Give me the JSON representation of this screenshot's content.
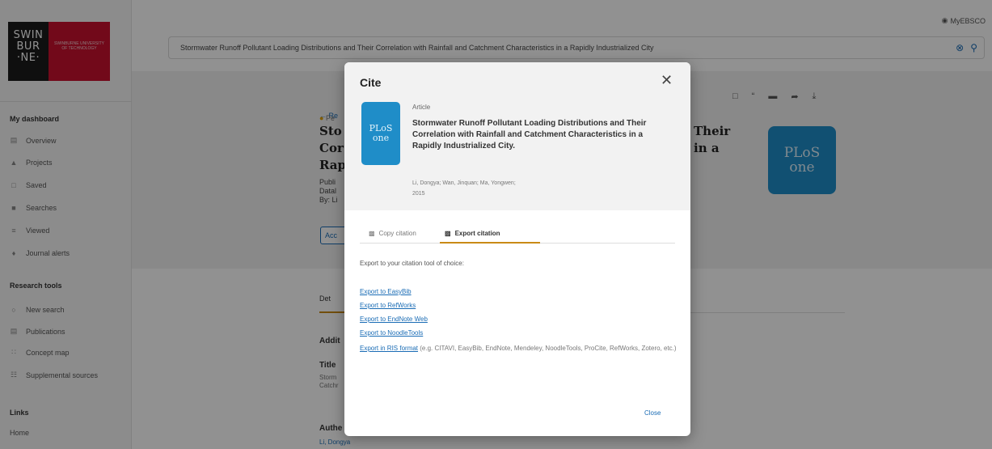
{
  "app": {
    "myebsco_label": "MyEBSCO"
  },
  "logo": {
    "wordmark_lines": [
      "SWIN",
      "BUR",
      "·NE·"
    ],
    "subtext": "SWINBURNE UNIVERSITY OF TECHNOLOGY"
  },
  "sidebar": {
    "dashboard_heading": "My dashboard",
    "dashboard_items": [
      {
        "label": "Overview",
        "icon": "overview-icon"
      },
      {
        "label": "Projects",
        "icon": "projects-icon"
      },
      {
        "label": "Saved",
        "icon": "saved-icon"
      },
      {
        "label": "Searches",
        "icon": "searches-icon"
      },
      {
        "label": "Viewed",
        "icon": "viewed-icon"
      },
      {
        "label": "Journal alerts",
        "icon": "journal-alerts-icon"
      }
    ],
    "research_heading": "Research tools",
    "research_items": [
      {
        "label": "New search",
        "icon": "new-search-icon"
      },
      {
        "label": "Publications",
        "icon": "publications-icon"
      },
      {
        "label": "Concept map",
        "icon": "concept-map-icon"
      },
      {
        "label": "Supplemental sources",
        "icon": "supplemental-sources-icon"
      }
    ],
    "links_heading": "Links",
    "links_items": [
      "Home"
    ]
  },
  "search": {
    "value": "Stormwater Runoff Pollutant Loading Distributions and Their Correlation with Rainfall and Catchment Characteristics in a Rapidly Industrialized City"
  },
  "background_record": {
    "back_label": "Re",
    "peer_label": "Pe",
    "title_left": [
      "Sto",
      "Cor",
      "Rap"
    ],
    "title_right": [
      "Their",
      "in a"
    ],
    "meta": [
      "Publi",
      "Datal",
      "By: Li"
    ],
    "access_label": "Acc",
    "thumb_lines": [
      "PLoS",
      "one"
    ],
    "tab_label": "Det",
    "additional_heading": "Addit",
    "title_heading": "Title",
    "title_value": [
      "Storm",
      "Catchr"
    ],
    "authors_heading": "Authe",
    "authors_value": "Li, Dongya"
  },
  "dialog": {
    "title": "Cite",
    "close_icon": "✕",
    "thumb_lines": [
      "PLoS",
      "one"
    ],
    "record_type": "Article",
    "article_title": "Stormwater Runoff Pollutant Loading Distributions and Their Correlation with Rainfall and Catchment Characteristics in a Rapidly Industrialized City.",
    "authors": "Li, Dongya; Wan, Jinquan; Ma, Yongwen;",
    "year": "2015",
    "tabs": {
      "copy": "Copy citation",
      "export": "Export citation"
    },
    "intro": "Export to your citation tool of choice:",
    "export_links": [
      "Export to EasyBib",
      "Export to RefWorks",
      "Export to EndNote Web",
      "Export to NoodleTools"
    ],
    "ris_link": "Export in RIS format",
    "ris_note": " (e.g. CITAVI, EasyBib, EndNote, Mendeley, NoodleTools, ProCite, RefWorks, Zotero, etc.)",
    "close_button": "Close"
  },
  "colors": {
    "accent": "#1a6cb5",
    "tab_underline": "#c98a16",
    "brand_red": "#c8102e",
    "plos_blue": "#1f8dc8"
  }
}
